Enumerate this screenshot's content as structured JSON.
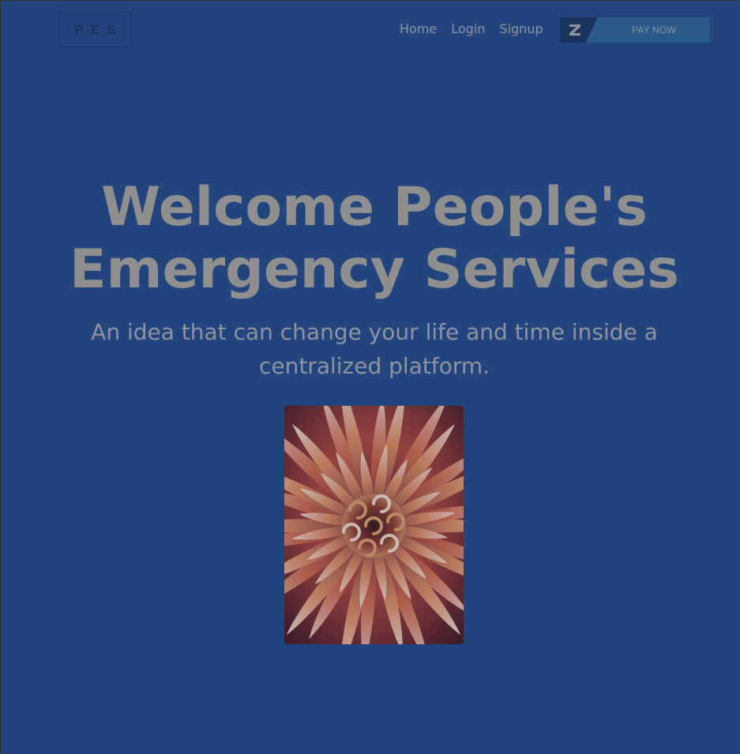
{
  "header": {
    "logo_text": "PES",
    "nav": [
      {
        "label": "Home"
      },
      {
        "label": "Login"
      },
      {
        "label": "Signup"
      }
    ],
    "pay_button": {
      "label": "PAY NOW",
      "icon": "z-logo-icon"
    }
  },
  "hero": {
    "title_line1": "Welcome People's",
    "title_line2": "Emergency Services",
    "subtitle_line1": "An idea that can change your life and time inside a",
    "subtitle_line2": "centralized platform.",
    "image": {
      "subject": "dahlia-flower-photo",
      "colors": [
        "#c0563f",
        "#e8b48c",
        "#5a1f2a",
        "#f0d8c8"
      ]
    }
  },
  "theme": {
    "background": "#22457d",
    "text_muted": "#8f959f",
    "title": "#8f8f8f"
  }
}
